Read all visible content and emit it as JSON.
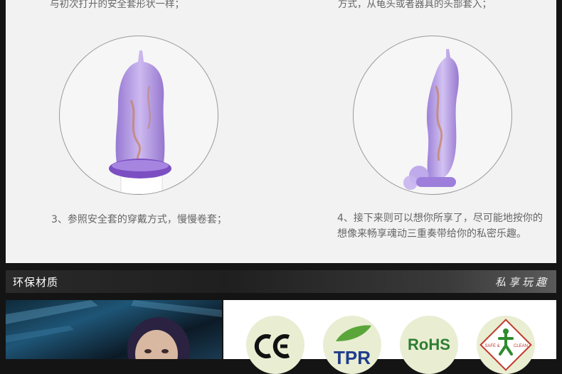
{
  "steps": {
    "caption_top_left": "与初次打开的安全套形状一样；",
    "caption_top_right": "方式，从龟头或者器具的头部套入；",
    "step3": "3、参照安全套的穿戴方式，慢慢卷套；",
    "step4": "4、接下来则可以想你所享了，尽可能地按你的想像来畅享魂动三重奏带给你的私密乐趣。"
  },
  "section": {
    "title": "环保材质",
    "brand": "私享玩趣"
  },
  "certifications": [
    {
      "icon": "ce-mark-icon",
      "label": "CE"
    },
    {
      "icon": "tpr-leaf-icon",
      "label": "TPR"
    },
    {
      "icon": "rohs-mark-icon",
      "label": "RoHS"
    },
    {
      "icon": "safe-clean-icon",
      "label_left": "SAFE &",
      "label_right": "CLEAN"
    }
  ],
  "colors": {
    "product_purple": "#a98ad8",
    "rohs_green": "#2e7d32",
    "tpr_blue": "#1f3c8c",
    "tpr_green": "#5aa63a"
  }
}
